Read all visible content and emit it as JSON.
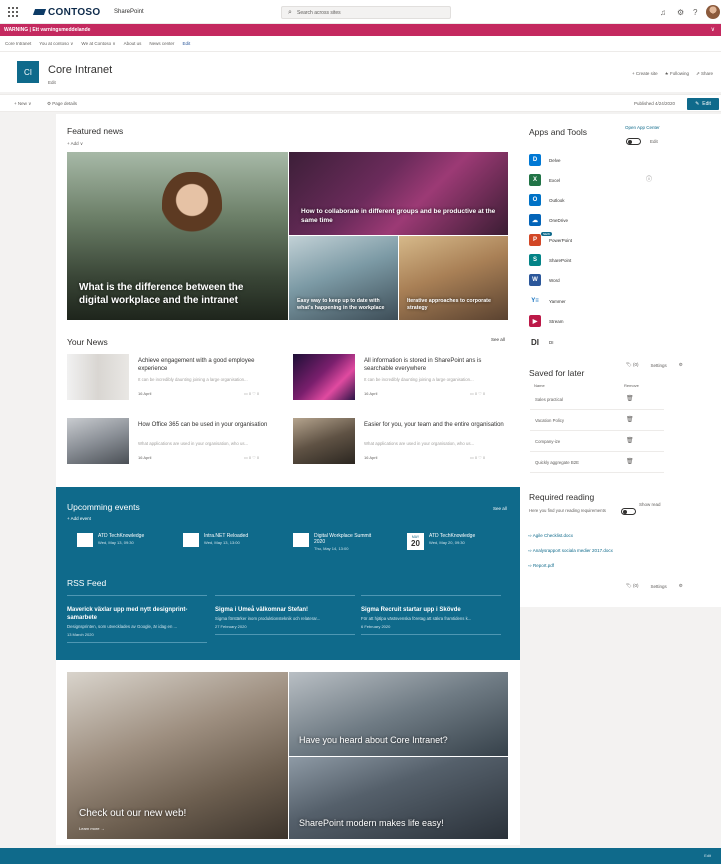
{
  "suite": {
    "brand": "CONTOSO",
    "app": "SharePoint",
    "search_placeholder": "Search across sites"
  },
  "warning": {
    "text": "WARNING | Ett varningsmeddelande"
  },
  "hubnav": [
    "Core Intranet",
    "You at contoso ∨",
    "We at Contoso ∨",
    "About us",
    "News center",
    "Edit"
  ],
  "site": {
    "logo": "CI",
    "title": "Core Intranet",
    "sub": "Edit",
    "create": "+ Create site",
    "following": "★ Following",
    "share": "⇗ Share"
  },
  "cmd": {
    "new": "+ New ∨",
    "page_details": "⚙ Page details",
    "published": "Published 4/24/2020",
    "edit": "Edit"
  },
  "featured": {
    "title": "Featured news",
    "add": "+ Add ∨",
    "items": [
      "What is the difference between the digital workplace and the intranet",
      "How to collaborate in different groups and be productive at the same time",
      "Easy way to keep up to date with what's happening in the workplace",
      "Iterative approaches to corporate strategy"
    ]
  },
  "your_news": {
    "title": "Your News",
    "see_all": "See all",
    "items": [
      {
        "title": "Achieve engagement with a good employee experience",
        "desc": "It can be incredibly daunting joining a large organisation...",
        "date": "16 April",
        "stats": "▭ 0   ♡ 0"
      },
      {
        "title": "All information is stored in SharePoint ans is searchable everywhere",
        "desc": "It can be incredibly daunting joining a large organisation...",
        "date": "16 April",
        "stats": "▭ 0   ♡ 0"
      },
      {
        "title": "How Office 365 can be used in your organisation",
        "desc": "What applications are used in your organisation, who us...",
        "date": "16 April",
        "stats": "▭ 0   ♡ 0"
      },
      {
        "title": "Easier for you, your team and the entire organisation",
        "desc": "What applications are used in your organisation, who us...",
        "date": "16 April",
        "stats": "▭ 0   ♡ 0"
      }
    ]
  },
  "events": {
    "title": "Upcomming events",
    "add": "+ Add event",
    "see_all": "See all",
    "items": [
      {
        "title": "ATD TechKnowledge",
        "when": "Wed, May 13, 09:30"
      },
      {
        "title": "Intra.NET Reloaded",
        "when": "Wed, May 13, 13:00"
      },
      {
        "title": "Digital Workplace Summit 2020",
        "when": "Thu, May 14, 13:00"
      },
      {
        "title": "ATD TechKnowledge",
        "when": "Wed, May 20, 09:30",
        "month": "MAY",
        "day": "20"
      }
    ]
  },
  "rss": {
    "title": "RSS Feed",
    "items": [
      {
        "title": "Maverick växlar upp med nytt designprint-samarbete",
        "desc": "Designsprinten, som utvecklades av Google, är idag en ...",
        "date": "13 March 2020"
      },
      {
        "title": "Sigma i Umeå välkomnar Stefan!",
        "desc": "Sigma förstärker inom produktionsteknik och relaterar...",
        "date": "27 February 2020"
      },
      {
        "title": "Sigma Recruit startar upp i Skövde",
        "desc": "För att hjälpa västsvenska företag att säkra framtidens k...",
        "date": "6 February 2020"
      }
    ]
  },
  "promo": {
    "main": "Check out our new web!",
    "learn": "Learn more →",
    "top": "Have you heard about Core Intranet?",
    "bottom": "SharePoint modern makes life easy!"
  },
  "apps": {
    "title": "Apps and Tools",
    "open": "Open App Center",
    "edit": "Edit",
    "items": [
      {
        "name": "Delve",
        "letter": "D",
        "color": "#0078d4"
      },
      {
        "name": "Excel",
        "letter": "X",
        "color": "#217346"
      },
      {
        "name": "Outlook",
        "letter": "O",
        "color": "#0072c6"
      },
      {
        "name": "OneDrive",
        "letter": "☁",
        "color": "#0364b8"
      },
      {
        "name": "PowerPoint",
        "letter": "P",
        "color": "#d24726"
      },
      {
        "name": "SharePoint",
        "letter": "S",
        "color": "#038387"
      },
      {
        "name": "Word",
        "letter": "W",
        "color": "#2b579a"
      },
      {
        "name": "Yammer",
        "letter": "Y≡",
        "color": "#ffffff"
      },
      {
        "name": "Stream",
        "letter": "▶",
        "color": "#bc1948"
      },
      {
        "name": "DI",
        "letter": "DI",
        "color": "#ffffff"
      }
    ],
    "new_badge": "NEW"
  },
  "saved": {
    "counter": "🏷 (0)",
    "settings": "Settings",
    "title": "Saved for later",
    "col_name": "Name",
    "col_remove": "Remove",
    "items": [
      "Sales practical",
      "Vacation Policy",
      "Company-ize",
      "Quickly aggregate B2E"
    ]
  },
  "required": {
    "title": "Required reading",
    "show": "Show read",
    "desc": "Here you find your reading requirements",
    "items": [
      "Agile Checklist.docx",
      "Analysrapport sociala medier 2017.docx",
      "Report.pdf"
    ],
    "counter": "🏷 (0)",
    "settings": "Settings"
  },
  "footer": {
    "text": "Edit"
  }
}
